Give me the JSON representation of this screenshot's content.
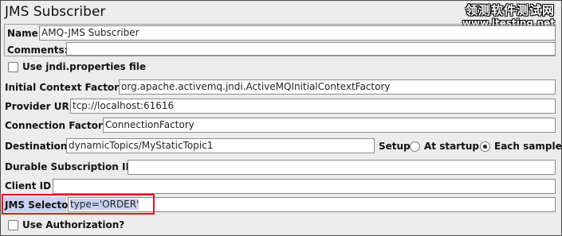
{
  "panel": {
    "title": "JMS Subscriber"
  },
  "watermark": {
    "name": "领测软件测试网",
    "url": "www.ltesting.net"
  },
  "fields": {
    "name_label": "Name:",
    "name_value": "AMQ-JMS Subscriber",
    "comments_label": "Comments:",
    "comments_value": "",
    "use_jndi_label": "Use jndi.properties file",
    "use_jndi_checked": false,
    "initial_context_label": "Initial Context Factory",
    "initial_context_value": "org.apache.activemq.jndi.ActiveMQInitialContextFactory",
    "provider_url_label": "Provider URL",
    "provider_url_value": "tcp://localhost:61616",
    "connection_factory_label": "Connection Factory",
    "connection_factory_value": "ConnectionFactory",
    "destination_label": "Destination",
    "destination_value": "dynamicTopics/MyStaticTopic1",
    "setup_label": "Setup",
    "setup_options": [
      "At startup",
      "Each sample"
    ],
    "setup_selected": "Each sample",
    "durable_label": "Durable Subscription ID",
    "durable_value": "",
    "client_id_label": "Client ID",
    "client_id_value": "",
    "jms_selector_label": "JMS Selector",
    "jms_selector_value": "type='ORDER'",
    "use_auth_label": "Use Authorization?",
    "use_auth_checked": false
  },
  "colors": {
    "panel_bg": "#ececec",
    "selection_bg": "#c8d2f0",
    "highlight_border": "#e8141b"
  }
}
